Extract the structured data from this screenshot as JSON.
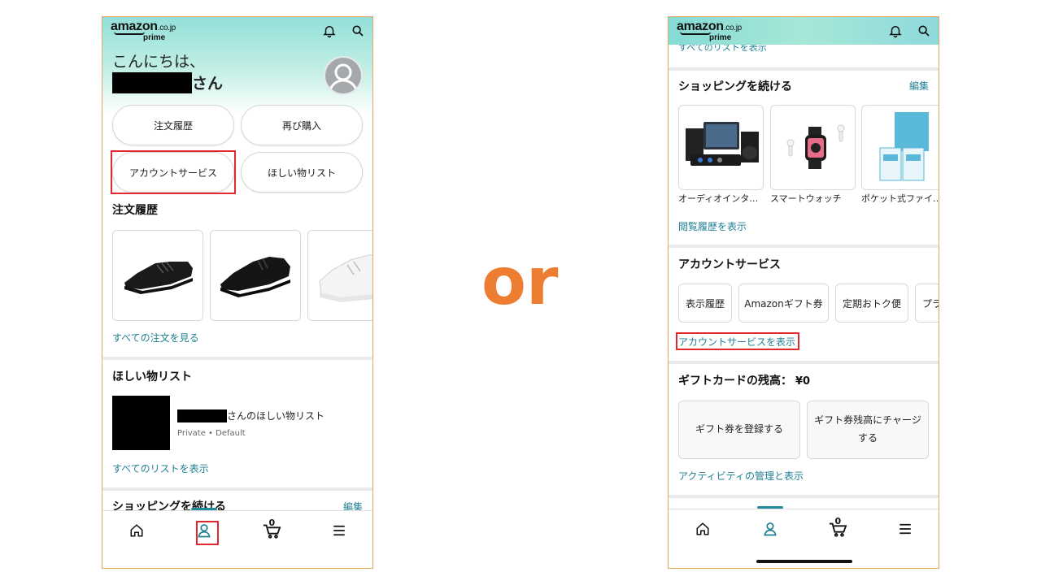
{
  "left": {
    "logo": {
      "brand": "amazon",
      "domain": ".co.jp",
      "sub": "prime"
    },
    "greeting": "こんにちは、",
    "name_suffix": "さん",
    "buttons": [
      "注文履歴",
      "再び購入",
      "アカウントサービス",
      "ほしい物リスト"
    ],
    "order_history": {
      "title": "注文履歴",
      "see_all": "すべての注文を見る"
    },
    "wishlist": {
      "title": "ほしい物リスト",
      "list_name": "さんのほしい物リスト",
      "meta": "Private • Default",
      "see_all": "すべてのリストを表示"
    },
    "continue_shopping": {
      "title": "ショッピングを続ける",
      "edit": "編集"
    },
    "cart_count": "0"
  },
  "separator": "or",
  "right": {
    "logo": {
      "brand": "amazon",
      "domain": ".co.jp",
      "sub": "prime"
    },
    "cut_link": "すべてのリストを表示",
    "continue_shopping": {
      "title": "ショッピングを続ける",
      "edit": "編集",
      "items": [
        "オーディオインタ…",
        "スマートウォッチ",
        "ポケット式ファイ…"
      ],
      "see_history": "閲覧履歴を表示"
    },
    "account_services": {
      "title": "アカウントサービス",
      "chips": [
        "表示履歴",
        "Amazonギフト券",
        "定期おトク便",
        "プラ"
      ],
      "see_all": "アカウントサービスを表示"
    },
    "gift_card": {
      "title": "ギフトカードの残高：",
      "balance": "¥0",
      "register": "ギフト券を登録する",
      "charge": "ギフト券残高にチャージする",
      "manage": "アクティビティの管理と表示"
    },
    "cart_count": "0"
  },
  "colors": {
    "accent": "#1f7f94",
    "highlight": "#e0282e",
    "or": "#ed7d31",
    "frame": "#e8a35c"
  }
}
